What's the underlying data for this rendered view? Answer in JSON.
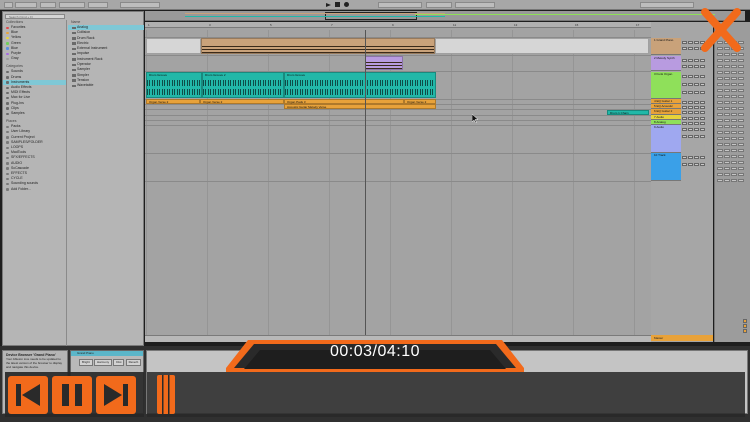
{
  "player": {
    "timecode": "00:03/04:10",
    "progress": 0.012,
    "accent_color": "#f26a1b",
    "controls": [
      {
        "name": "skip-back-icon"
      },
      {
        "name": "pause-icon"
      },
      {
        "name": "skip-forward-icon"
      }
    ],
    "close_icon": "close-icon"
  },
  "browser": {
    "search_placeholder": "Search (Cmd + F)",
    "collections_header": "Collections",
    "collections": [
      {
        "label": "Favorites",
        "color": "#e04a4a"
      },
      {
        "label": "Blue",
        "color": "#e8a23a"
      },
      {
        "label": "Yellow",
        "color": "#e8d33a"
      },
      {
        "label": "Green",
        "color": "#6fcf5a"
      },
      {
        "label": "Blue",
        "color": "#5a8fe0"
      },
      {
        "label": "Purple",
        "color": "#a56ae0"
      },
      {
        "label": "Gray",
        "color": "#9c9c9c"
      }
    ],
    "categories_header": "Categories",
    "categories": [
      {
        "label": "Sounds",
        "selected": false
      },
      {
        "label": "Drums",
        "selected": false
      },
      {
        "label": "Instruments",
        "selected": true
      },
      {
        "label": "Audio Effects",
        "selected": false
      },
      {
        "label": "MIDI Effects",
        "selected": false
      },
      {
        "label": "Max for Live",
        "selected": false
      },
      {
        "label": "Plug-Ins",
        "selected": false
      },
      {
        "label": "Clips",
        "selected": false
      },
      {
        "label": "Samples",
        "selected": false
      }
    ],
    "places_header": "Places",
    "places": [
      "Packs",
      "User Library",
      "Current Project",
      "SAMPLES/FOLDER",
      "LOOPS",
      "MadTools",
      "SFX/EFFECTS",
      "AUDIO",
      "ScCascade",
      "EFFECTS",
      "CYCLE",
      "Sounding sounds",
      "Add Folder..."
    ],
    "column_header": "Name",
    "items": [
      {
        "label": "Analog",
        "selected": true
      },
      {
        "label": "Collision",
        "selected": false
      },
      {
        "label": "Drum Rack",
        "selected": false
      },
      {
        "label": "Electric",
        "selected": false
      },
      {
        "label": "External Instrument",
        "selected": false
      },
      {
        "label": "Impulse",
        "selected": false
      },
      {
        "label": "Instrument Rack",
        "selected": false
      },
      {
        "label": "Operator",
        "selected": false
      },
      {
        "label": "Sampler",
        "selected": false
      },
      {
        "label": "Simpler",
        "selected": false
      },
      {
        "label": "Tension",
        "selected": false
      },
      {
        "label": "Wavetable",
        "selected": false
      }
    ]
  },
  "arrangement": {
    "bar_numbers": [
      "1",
      "3",
      "5",
      "7",
      "9",
      "11",
      "13",
      "15",
      "17"
    ],
    "clips": [
      {
        "label": "",
        "track": 0,
        "color": "#c9a27a"
      },
      {
        "label": "",
        "track": 1,
        "color": "#b89be0"
      },
      {
        "label": "Drum Groove",
        "track": 2,
        "color": "#22b8a8"
      },
      {
        "label": "Drum Groove 2",
        "track": 2,
        "color": "#22b8a8"
      },
      {
        "label": "Drum Groove",
        "track": 2,
        "color": "#22b8a8"
      },
      {
        "label": "Organ Verse 2",
        "track": 3,
        "color": "#e8a23a"
      },
      {
        "label": "Organ Verse 2",
        "track": 3,
        "color": "#e8a23a"
      },
      {
        "label": "Organ Pads 3",
        "track": 3,
        "color": "#e8a23a"
      },
      {
        "label": "Organ Verse 2",
        "track": 3,
        "color": "#e8a23a"
      },
      {
        "label": "Acoustic Guitar Melody Verse",
        "track": 4,
        "color": "#e8a23a"
      },
      {
        "label": "Drum 1 Chain",
        "track": 5,
        "color": "#22b8a8"
      }
    ]
  },
  "tracks": [
    {
      "label": "1 Grand Piano",
      "color": "#c9a27a"
    },
    {
      "label": "2 Melody Synth",
      "color": "#b89be0"
    },
    {
      "label": "3 Funk Organ",
      "color": "#8fe05a"
    },
    {
      "label": "4 EQ Guitar 1",
      "color": "#e8a23a"
    },
    {
      "label": "5 EQ Acoustic",
      "color": "#e8a23a"
    },
    {
      "label": "6 EQ Guitar 2",
      "color": "#e8a23a"
    },
    {
      "label": "7 Audio",
      "color": "#e8d33a"
    },
    {
      "label": "8 Analog",
      "color": "#8fe05a"
    },
    {
      "label": "9 Audio",
      "color": "#9fa8f0"
    },
    {
      "label": "10 Track",
      "color": "#3aa0e8"
    }
  ],
  "master_label": "Master",
  "info_view": {
    "title": "Device Browser 'Grand Piano'",
    "body": "Your Ableton Live needs to be updated to the latest version of the browser to display and navigate this device."
  },
  "device": {
    "title": "Grand Piano",
    "tabs": [
      "Bright",
      "Harmony",
      "Dist",
      "Reverb"
    ]
  }
}
